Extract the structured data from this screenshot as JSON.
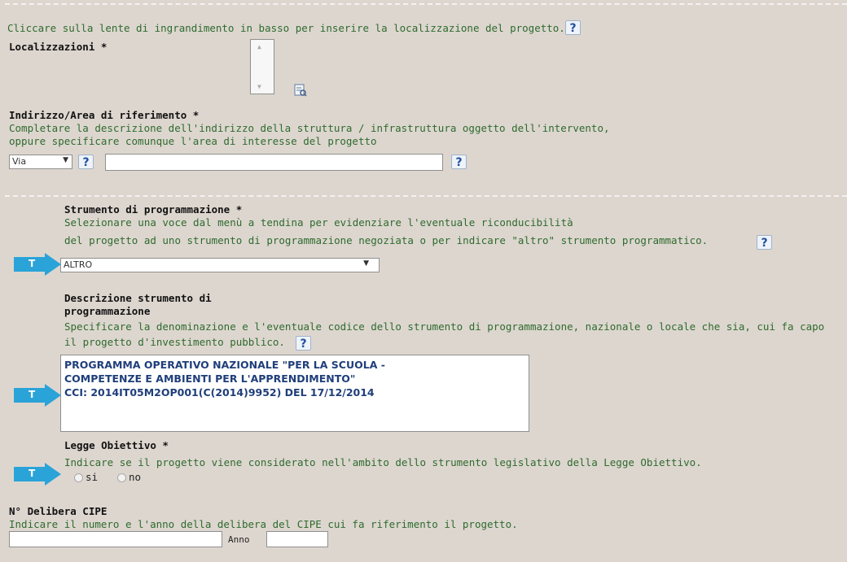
{
  "localizzazione": {
    "hint": "Cliccare sulla lente di ingrandimento in basso per inserire la localizzazione del progetto.",
    "label": "Localizzazioni *",
    "help": "?"
  },
  "indirizzo": {
    "label": "Indirizzo/Area di riferimento *",
    "hint_line1": "Completare la descrizione dell'indirizzo della struttura / infrastruttura oggetto dell'intervento,",
    "hint_line2": "oppure specificare comunque l'area di interesse del progetto",
    "select_value": "Via",
    "help": "?"
  },
  "strumento": {
    "label": "Strumento di programmazione *",
    "hint_line1": "Selezionare una voce dal menù a tendina per evidenziare l'eventuale riconducibilità",
    "hint_line2": "del progetto ad uno strumento di programmazione negoziata o per indicare \"altro\" strumento programmatico.",
    "select_value": "ALTRO",
    "help": "?"
  },
  "descrizione": {
    "label_line1": "Descrizione strumento di",
    "label_line2": "programmazione",
    "hint_line1": "Specificare la denominazione e l'eventuale codice dello strumento di programmazione, nazionale o locale che sia, cui fa capo",
    "hint_line2": "il progetto d'investimento pubblico.",
    "value": "PROGRAMMA OPERATIVO NAZIONALE \"PER LA SCUOLA -\nCOMPETENZE E AMBIENTI PER L'APPRENDIMENTO\"\nCCI: 2014IT05M2OP001(C(2014)9952) DEL 17/12/2014",
    "help": "?"
  },
  "legge": {
    "label": "Legge Obiettivo *",
    "hint": "Indicare se il progetto viene considerato nell'ambito dello strumento legislativo della Legge Obiettivo.",
    "option_si": "si",
    "option_no": "no"
  },
  "cipe": {
    "label": "N° Delibera CIPE",
    "hint": "Indicare il numero e l'anno della delibera del CIPE cui fa riferimento il progetto.",
    "anno_label": "Anno"
  },
  "markers": [
    "T",
    "T",
    "T"
  ],
  "colors": {
    "marker": "#2aa3d8",
    "hint_text": "#2e6b2e",
    "textarea_text": "#1f3e7a"
  }
}
